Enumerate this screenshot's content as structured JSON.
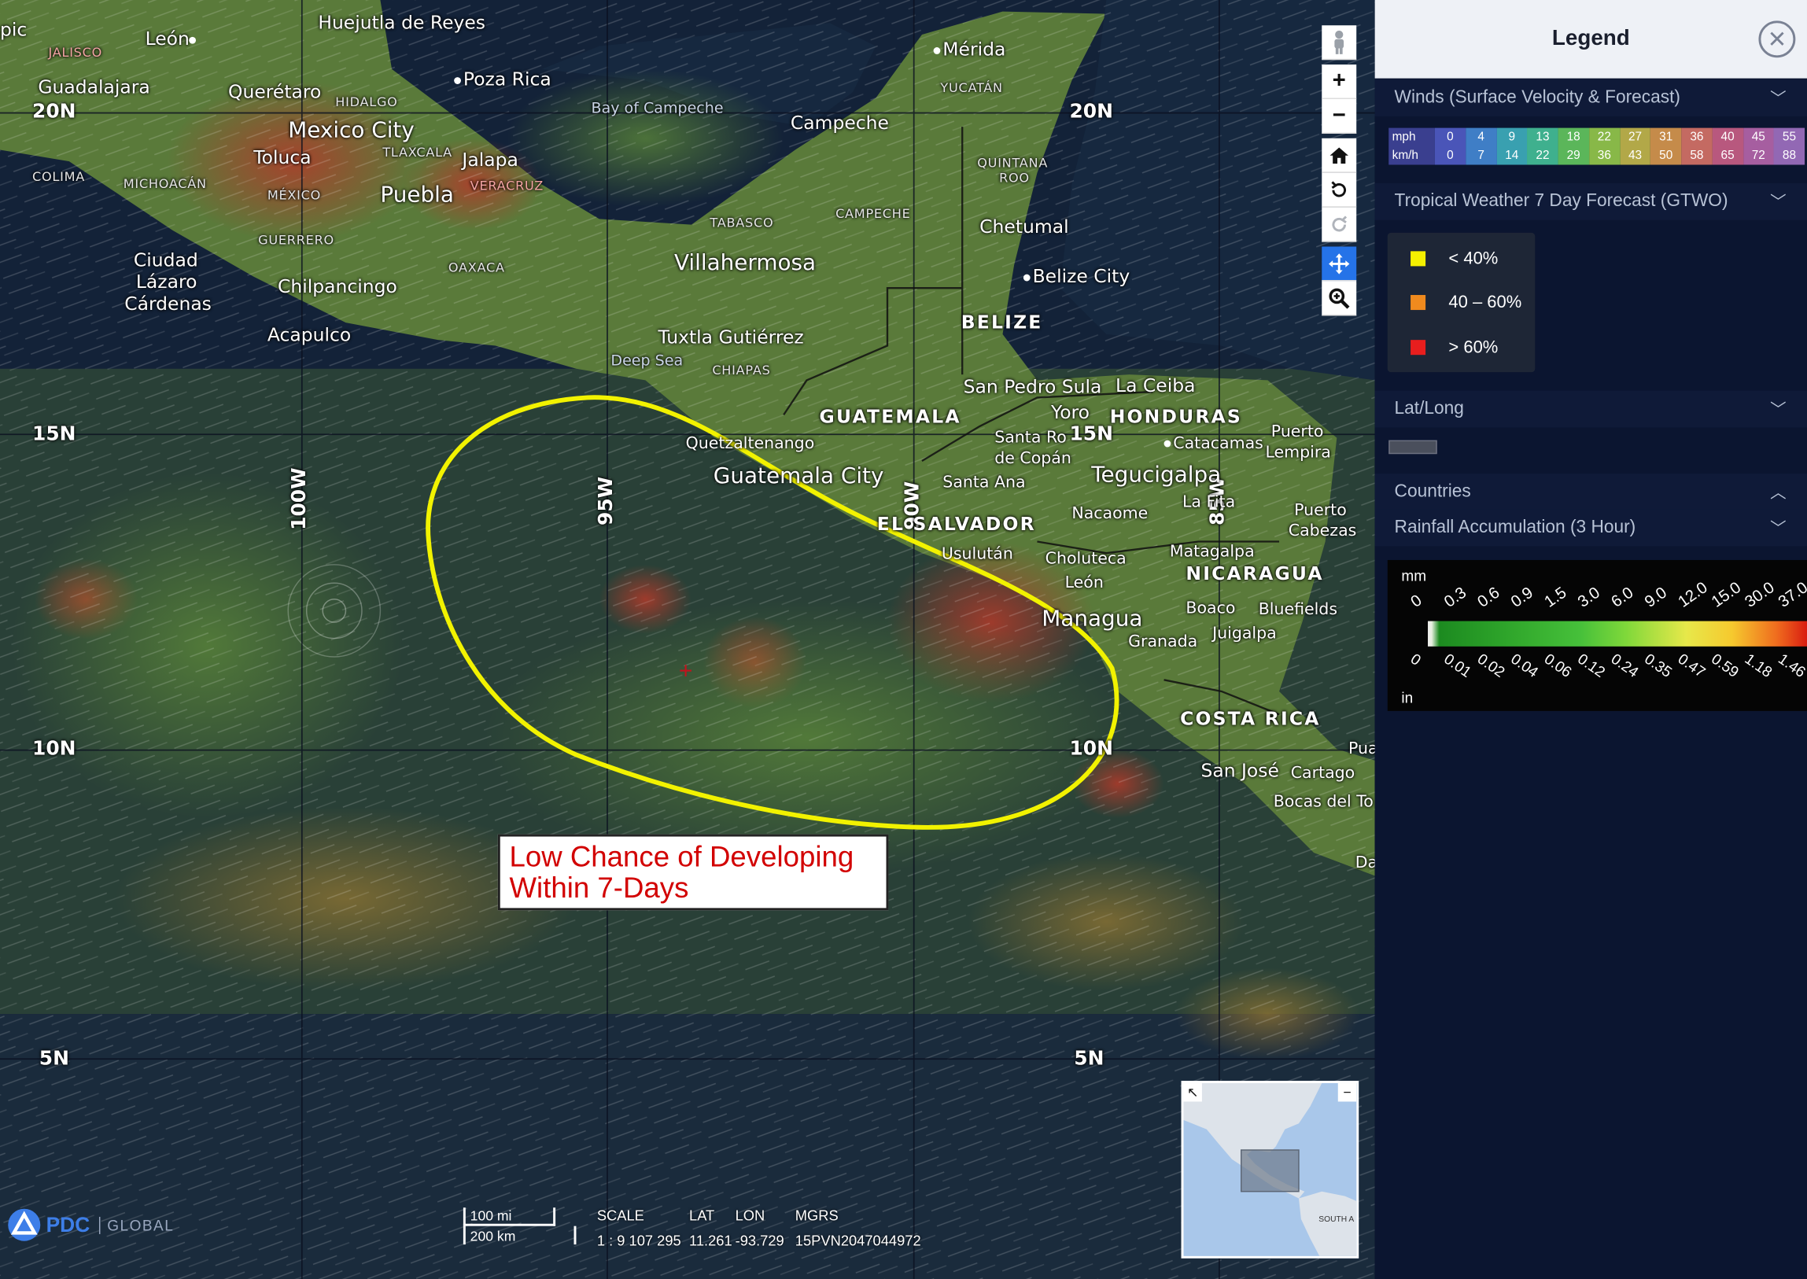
{
  "map": {
    "grid_labels": {
      "lat_20n_left": "20N",
      "lat_20n_right": "20N",
      "lat_15n_left": "15N",
      "lat_15n_right": "15N",
      "lat_10n_left": "10N",
      "lat_10n_right": "10N",
      "lat_5n_left": "5N",
      "lat_5n_right": "5N",
      "lon_100w": "100W",
      "lon_95w": "95W",
      "lon_90w": "90W",
      "lon_85w": "85W"
    },
    "places": {
      "pic": "pic",
      "leon_mx": "León",
      "huejutla": "Huejutla de Reyes",
      "merida": "Mérida",
      "yucatan": "YUCATÁN",
      "jalisco": "JALISCO",
      "guadalajara": "Guadalajara",
      "queretaro": "Querétaro",
      "hidalgo": "HIDALGO",
      "poza_rica": "Poza Rica",
      "bay_of_campeche": "Bay of Campeche",
      "campeche_city": "Campeche",
      "mexico_city": "Mexico City",
      "toluca": "Toluca",
      "tlaxcala": "TLAXCALA",
      "jalapa": "Jalapa",
      "colima": "COLIMA",
      "michoacan": "MICHOACÁN",
      "mexico_state": "MÉXICO",
      "puebla": "Puebla",
      "veracruz": "VERACRUZ",
      "quintana_roo_1": "QUINTANA",
      "quintana_roo_2": "ROO",
      "tabasco": "TABASCO",
      "campeche_state": "CAMPECHE",
      "chetumal": "Chetumal",
      "guerrero": "GUERRERO",
      "oaxaca": "OAXACA",
      "villahermosa": "Villahermosa",
      "belize_city": "Belize City",
      "ciudad_lc_1": "Ciudad",
      "ciudad_lc_2": "Lázaro",
      "ciudad_lc_3": "Cárdenas",
      "chilpancingo": "Chilpancingo",
      "acapulco": "Acapulco",
      "tuxtla": "Tuxtla Gutiérrez",
      "chiapas": "CHIAPAS",
      "belize": "BELIZE",
      "deep_sea": "Deep Sea",
      "san_pedro_sula": "San Pedro Sula",
      "la_ceiba": "La Ceiba",
      "guatemala": "GUATEMALA",
      "yoro": "Yoro",
      "honduras": "HONDURAS",
      "quetzaltenango": "Quetzaltenango",
      "santa_rosa_1": "Santa Ro",
      "santa_rosa_2": "de Copán",
      "catacamas": "Catacamas",
      "puerto_lempira_1": "Puerto",
      "puerto_lempira_2": "Lempira",
      "guatemala_city": "Guatemala City",
      "santa_ana": "Santa Ana",
      "tegucigalpa": "Tegucigalpa",
      "la_fita": "La Fita",
      "puerto_cabezas_1": "Puerto",
      "puerto_cabezas_2": "Cabezas",
      "nacaome": "Nacaome",
      "el_salvador": "EL SALVADOR",
      "usulutan": "Usulután",
      "matagalpa": "Matagalpa",
      "choluteca": "Choluteca",
      "nicaragua": "NICARAGUA",
      "leon_ni": "León",
      "boaco": "Boaco",
      "bluefields": "Bluefields",
      "managua": "Managua",
      "juigalpa": "Juigalpa",
      "granada": "Granada",
      "costa_rica": "COSTA RICA",
      "pua": "Pua",
      "san_jose": "San José",
      "cartago": "Cartago",
      "bocas": "Bocas del To",
      "da": "Da"
    },
    "annotation": {
      "line1": "Low Chance of Developing",
      "line2": "Within 7-Days"
    },
    "minimap_label": "SOUTH A",
    "logo": {
      "brand": "PDC",
      "global": "GLOBAL"
    },
    "scale_bar": {
      "top": "100 mi",
      "bottom": "200 km"
    },
    "readout": {
      "scale_label": "SCALE",
      "scale_value": "1 : 9 107 295",
      "lat_label": "LAT",
      "lat_value": "11.261",
      "lon_label": "LON",
      "lon_value": "-93.729",
      "mgrs_label": "MGRS",
      "mgrs_value": "15PVN2047044972"
    }
  },
  "toolbar": {
    "pegman": "pegman-icon",
    "zoom_in": "+",
    "zoom_out": "−",
    "home": "home-icon",
    "rotate_ccw": "rotate-left-icon",
    "rotate_cw": "rotate-right-icon",
    "pan": "pan-icon",
    "zoom_box": "zoom-box-icon"
  },
  "legend": {
    "title": "Legend",
    "sections": {
      "winds": "Winds (Surface Velocity & Forecast)",
      "gtwo": "Tropical Weather 7 Day Forecast (GTWO)",
      "latlong": "Lat/Long",
      "countries": "Countries",
      "rainfall": "Rainfall Accumulation (3 Hour)"
    },
    "wind_units": {
      "mph": "mph",
      "kmh": "km/h"
    },
    "wind_scale": [
      {
        "mph": "0",
        "kmh": "0",
        "color": "#4a55b8"
      },
      {
        "mph": "4",
        "kmh": "7",
        "color": "#3f7ec6"
      },
      {
        "mph": "9",
        "kmh": "14",
        "color": "#39a0b0"
      },
      {
        "mph": "13",
        "kmh": "22",
        "color": "#3fb08e"
      },
      {
        "mph": "18",
        "kmh": "29",
        "color": "#5bb65a"
      },
      {
        "mph": "22",
        "kmh": "36",
        "color": "#88b848"
      },
      {
        "mph": "27",
        "kmh": "43",
        "color": "#b2a848"
      },
      {
        "mph": "31",
        "kmh": "50",
        "color": "#c58b4a"
      },
      {
        "mph": "36",
        "kmh": "58",
        "color": "#c46a62"
      },
      {
        "mph": "40",
        "kmh": "65",
        "color": "#b8587e"
      },
      {
        "mph": "45",
        "kmh": "72",
        "color": "#a65ea0"
      },
      {
        "mph": "55",
        "kmh": "88",
        "color": "#9268b4"
      }
    ],
    "gtwo_items": [
      {
        "label": "< 40%",
        "color": "#f5f000"
      },
      {
        "label": "40 – 60%",
        "color": "#f08a1e"
      },
      {
        "label": "> 60%",
        "color": "#e81e1e"
      }
    ],
    "rain": {
      "unit_top": "mm",
      "unit_bottom": "in",
      "mm_ticks": [
        "0",
        "0.3",
        "0.6",
        "0.9",
        "1.5",
        "3.0",
        "6.0",
        "9.0",
        "12.0",
        "15.0",
        "30.0",
        "37.0"
      ],
      "in_ticks": [
        "0",
        "0.01",
        "0.02",
        "0.04",
        "0.06",
        "0.12",
        "0.24",
        "0.35",
        "0.47",
        "0.59",
        "1.18",
        "1.46"
      ]
    }
  }
}
